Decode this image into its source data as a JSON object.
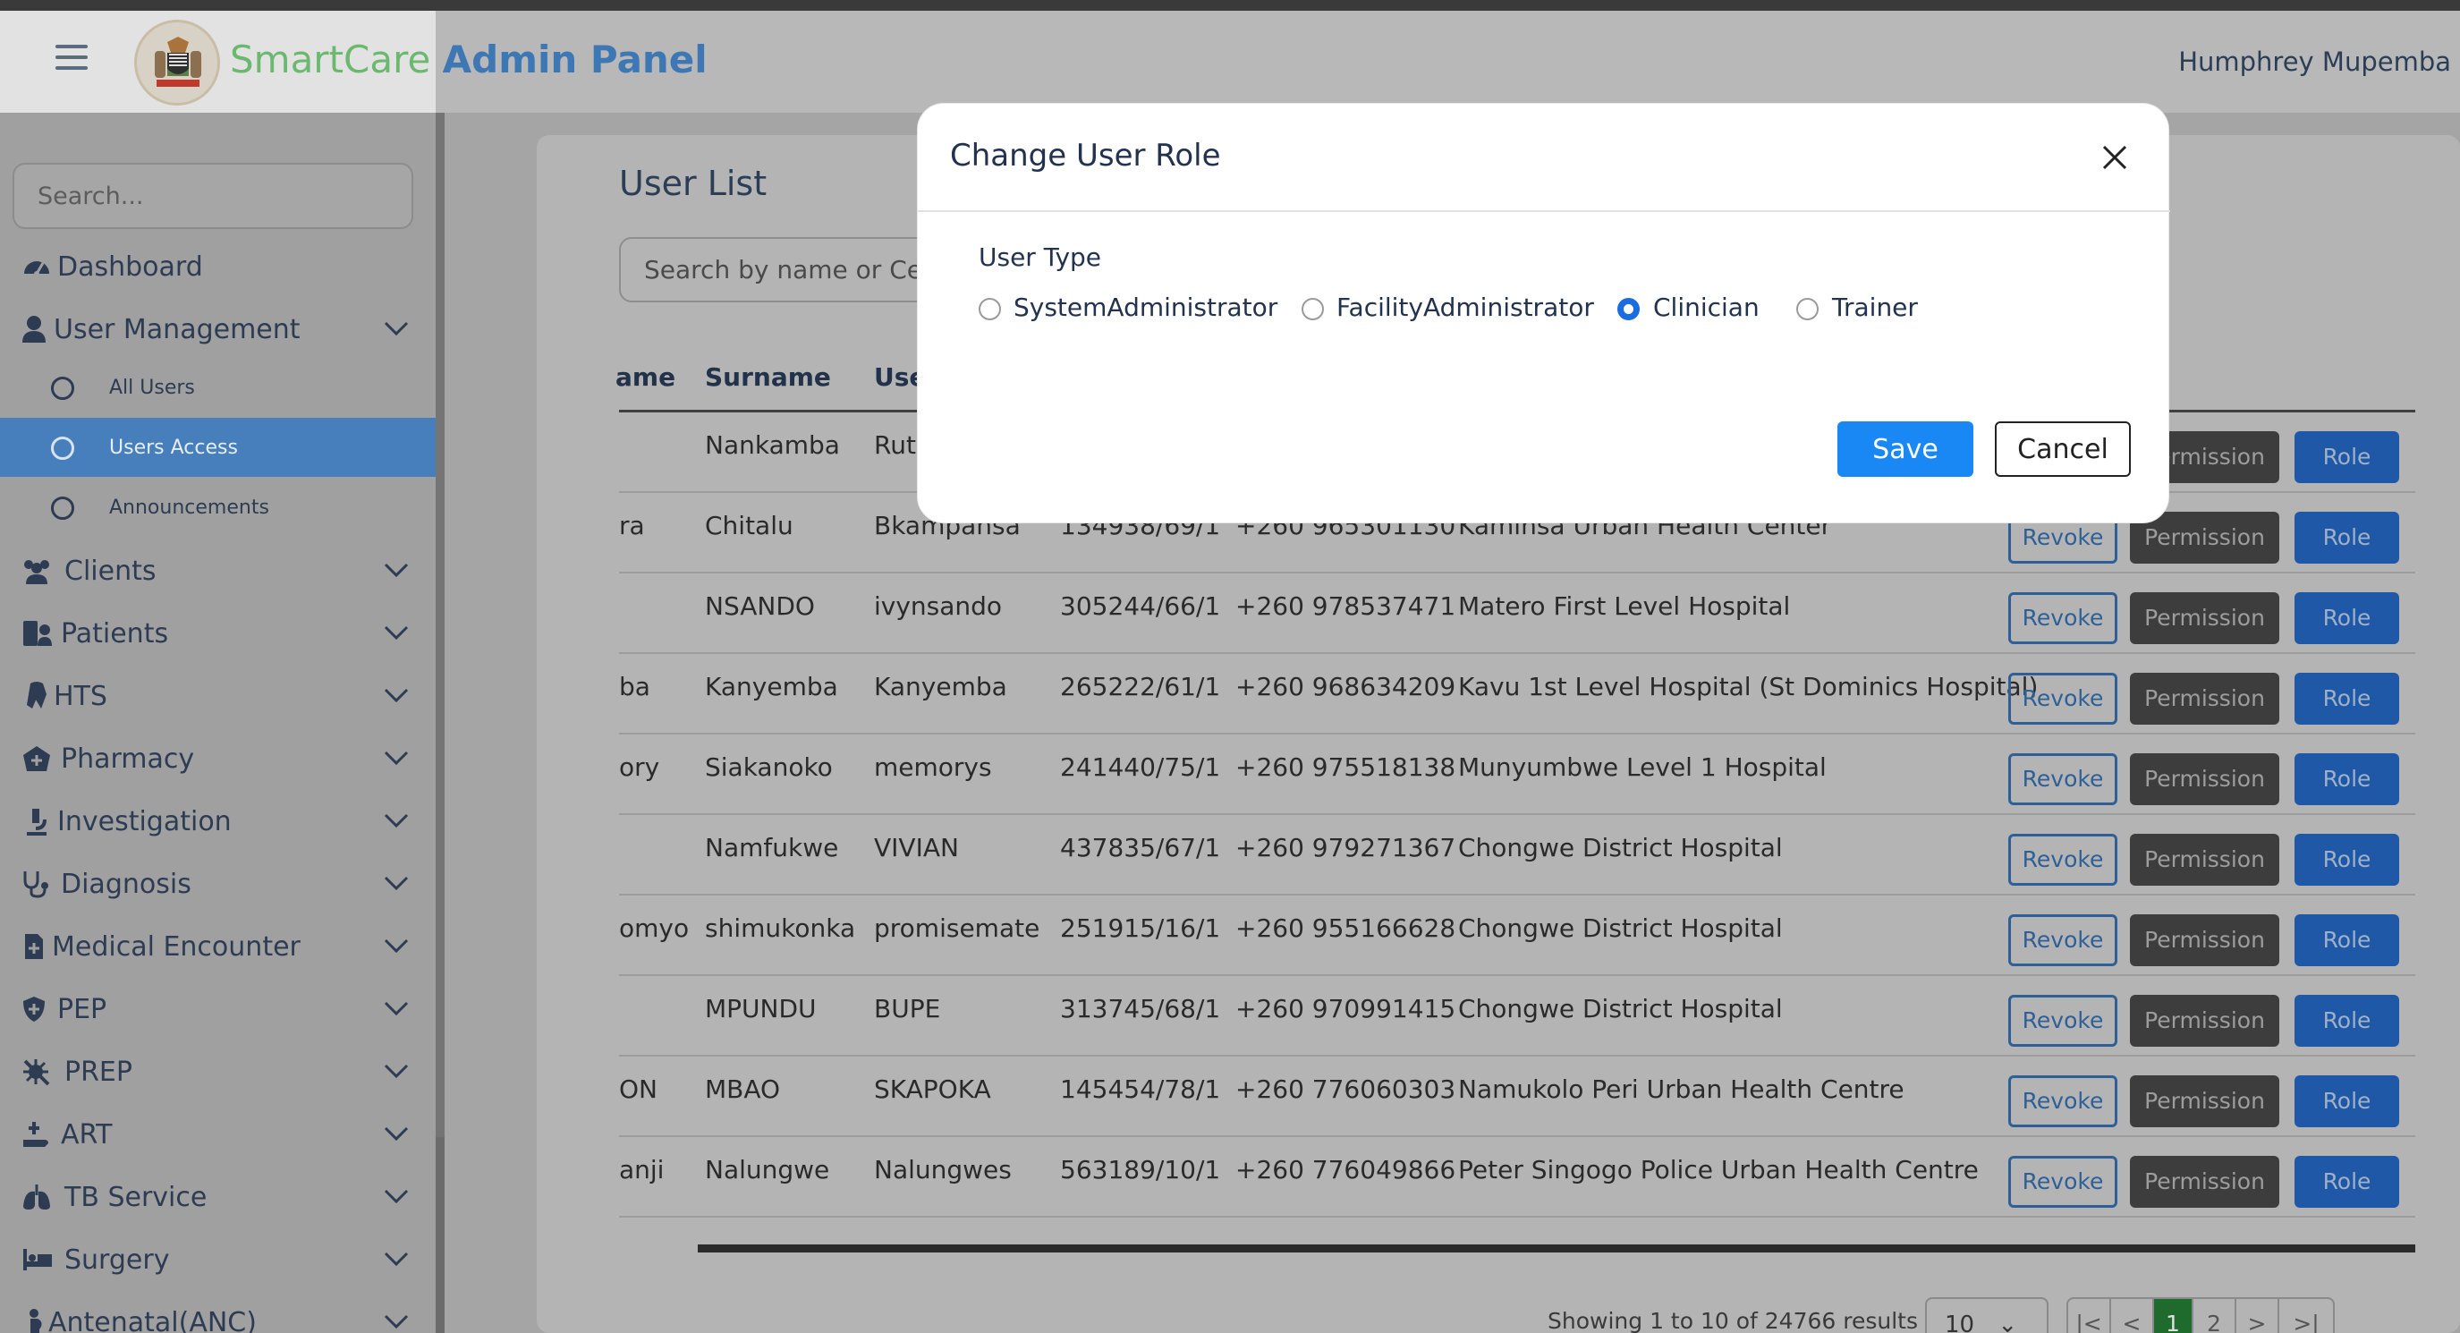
{
  "app": {
    "brand_part1": "SmartCare",
    "brand_part2": "Admin Panel",
    "user_name": "Humphrey Mupemba"
  },
  "sidebar": {
    "search_placeholder": "Search...",
    "items": [
      {
        "label": "Dashboard",
        "icon": "dashboard-icon"
      },
      {
        "label": "User Management",
        "icon": "user-icon",
        "expanded": true
      },
      {
        "label": "Clients",
        "icon": "users-icon"
      },
      {
        "label": "Patients",
        "icon": "patient-icon"
      },
      {
        "label": "HTS",
        "icon": "ribbon-icon"
      },
      {
        "label": "Pharmacy",
        "icon": "pharmacy-icon"
      },
      {
        "label": "Investigation",
        "icon": "microscope-icon"
      },
      {
        "label": "Diagnosis",
        "icon": "stethoscope-icon"
      },
      {
        "label": "Medical Encounter",
        "icon": "file-medical-icon"
      },
      {
        "label": "PEP",
        "icon": "shield-icon"
      },
      {
        "label": "PREP",
        "icon": "virus-icon"
      },
      {
        "label": "ART",
        "icon": "hand-medical-icon"
      },
      {
        "label": "TB Service",
        "icon": "lungs-icon"
      },
      {
        "label": "Surgery",
        "icon": "bed-icon"
      },
      {
        "label": "Antenatal(ANC)",
        "icon": "pregnant-icon"
      }
    ],
    "sub_items": [
      {
        "label": "All Users"
      },
      {
        "label": "Users Access",
        "active": true
      },
      {
        "label": "Announcements"
      }
    ]
  },
  "main": {
    "title": "User List",
    "search_placeholder": "Search by name or Cell",
    "columns": [
      "ame",
      "Surname",
      "Use"
    ],
    "rows": [
      {
        "first": "",
        "surname": "Nankamba",
        "username": "Ruti",
        "nrc": "",
        "phone": "",
        "facility": ""
      },
      {
        "first": "ra",
        "surname": "Chitalu",
        "username": "Bkampansa",
        "nrc": "134938/69/1",
        "phone": "+260 965301130",
        "facility": "Kaminsa Urban Health Center"
      },
      {
        "first": "",
        "surname": "NSANDO",
        "username": "ivynsando",
        "nrc": "305244/66/1",
        "phone": "+260 978537471",
        "facility": "Matero First Level Hospital"
      },
      {
        "first": "ba",
        "surname": "Kanyemba",
        "username": "Kanyemba",
        "nrc": "265222/61/1",
        "phone": "+260 968634209",
        "facility": "Kavu 1st Level Hospital (St Dominics Hospital)"
      },
      {
        "first": "ory",
        "surname": "Siakanoko",
        "username": "memorys",
        "nrc": "241440/75/1",
        "phone": "+260 975518138",
        "facility": "Munyumbwe Level 1 Hospital"
      },
      {
        "first": "",
        "surname": "Namfukwe",
        "username": "VIVIAN",
        "nrc": "437835/67/1",
        "phone": "+260 979271367",
        "facility": "Chongwe District Hospital"
      },
      {
        "first": "omyo",
        "surname": "shimukonka",
        "username": "promisemate",
        "nrc": "251915/16/1",
        "phone": "+260 955166628",
        "facility": "Chongwe District Hospital"
      },
      {
        "first": "",
        "surname": "MPUNDU",
        "username": "BUPE",
        "nrc": "313745/68/1",
        "phone": "+260 970991415",
        "facility": "Chongwe District Hospital"
      },
      {
        "first": "ON",
        "surname": "MBAO",
        "username": "SKAPOKA",
        "nrc": "145454/78/1",
        "phone": "+260 776060303",
        "facility": "Namukolo Peri Urban Health Centre"
      },
      {
        "first": "anji",
        "surname": "Nalungwe",
        "username": "Nalungwes",
        "nrc": "563189/10/1",
        "phone": "+260 776049866",
        "facility": "Peter Singogo Police Urban Health Centre"
      }
    ],
    "buttons": {
      "revoke": "Revoke",
      "permission": "Permission",
      "role": "Role"
    },
    "footer": {
      "showing": "Showing 1 to 10 of 24766 results",
      "page_size": "10",
      "pages": [
        "1",
        "2"
      ],
      "current_page": "1",
      "first": "|<",
      "prev": "<",
      "next": ">",
      "last": ">|"
    }
  },
  "modal": {
    "title": "Change User Role",
    "field_label": "User Type",
    "options": [
      "SystemAdministrator",
      "FacilityAdministrator",
      "Clinician",
      "Trainer"
    ],
    "selected": "Clinician",
    "save_label": "Save",
    "cancel_label": "Cancel"
  },
  "colors": {
    "accent": "#1a88f4",
    "brand_green": "#6bb86f",
    "brand_blue": "#3d78b5",
    "active_nav": "#477fbd",
    "role_button": "#1f58a6",
    "page_active": "#1e6b2d"
  }
}
